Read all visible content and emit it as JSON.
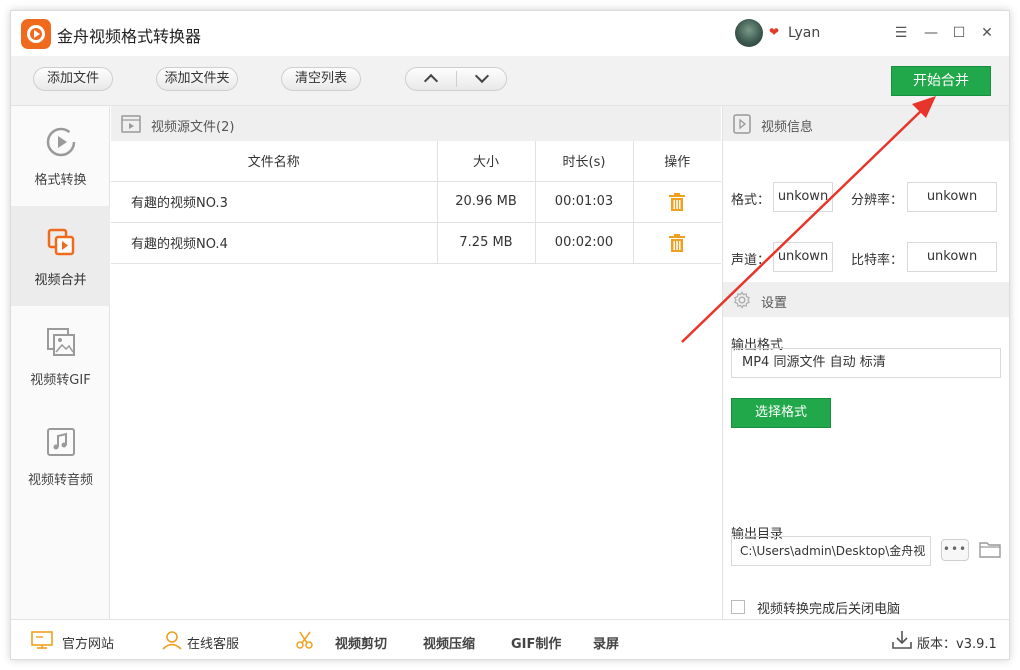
{
  "app": {
    "title": "金舟视频格式转换器",
    "username": "Lyan"
  },
  "window_controls": {
    "menu": "☰",
    "minimize": "—",
    "maximize": "☐",
    "close": "✕"
  },
  "toolbar": {
    "add_file": "添加文件",
    "add_folder": "添加文件夹",
    "clear_list": "清空列表",
    "start_merge": "开始合并"
  },
  "sidebar": {
    "items": [
      {
        "label": "格式转换",
        "icon": "play-circle-icon",
        "active": false
      },
      {
        "label": "视频合并",
        "icon": "merge-icon",
        "active": true
      },
      {
        "label": "视频转GIF",
        "icon": "image-icon",
        "active": false
      },
      {
        "label": "视频转音频",
        "icon": "music-note-icon",
        "active": false
      }
    ]
  },
  "file_panel": {
    "title": "视频源文件(2)",
    "columns": [
      "文件名称",
      "大小",
      "时长(s)",
      "操作"
    ],
    "rows": [
      {
        "name": "有趣的视频NO.3",
        "size": "20.96 MB",
        "duration": "00:01:03"
      },
      {
        "name": "有趣的视频NO.4",
        "size": "7.25 MB",
        "duration": "00:02:00"
      }
    ]
  },
  "video_info": {
    "title": "视频信息",
    "format_label": "格式：",
    "format_value": "unkown",
    "resolution_label": "分辨率：",
    "resolution_value": "unkown",
    "channel_label": "声道：",
    "channel_value": "unkown",
    "bitrate_label": "比特率：",
    "bitrate_value": "unkown"
  },
  "settings": {
    "title": "设置",
    "output_format_label": "输出格式",
    "output_format_value": "MP4 同源文件 自动 标清",
    "choose_format": "选择格式",
    "output_dir_label": "输出目录",
    "output_dir_value": "C:\\Users\\admin\\Desktop\\金舟视",
    "more": "•••",
    "shutdown_label": "视频转换完成后关闭电脑"
  },
  "footer": {
    "website": "官方网站",
    "support": "在线客服",
    "video_cut": "视频剪切",
    "video_compress": "视频压缩",
    "gif_make": "GIF制作",
    "record": "录屏",
    "version": "版本：v3.9.1"
  },
  "colors": {
    "accent_green": "#20a84a",
    "accent_orange": "#f06a1d",
    "annotation_red": "#e8352b"
  }
}
